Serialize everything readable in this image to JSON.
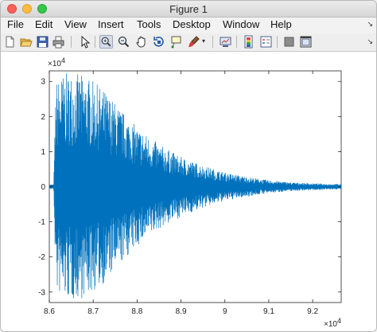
{
  "window": {
    "title": "Figure 1"
  },
  "menu": {
    "items": [
      "File",
      "Edit",
      "View",
      "Insert",
      "Tools",
      "Desktop",
      "Window",
      "Help"
    ],
    "corner_icon": "undock-arrow-icon"
  },
  "toolbar": {
    "icons": [
      "new-figure-icon",
      "open-file-icon",
      "save-icon",
      "print-icon",
      "edit-plot-arrow-icon",
      "zoom-in-icon",
      "zoom-out-icon",
      "pan-hand-icon",
      "rotate-3d-icon",
      "data-cursor-icon",
      "brush-icon",
      "link-plot-icon",
      "insert-colorbar-icon",
      "insert-legend-icon",
      "hide-plot-tools-icon",
      "show-plot-tools-icon"
    ],
    "active_icon": "zoom-in-icon"
  },
  "chart_data": {
    "type": "line",
    "x_multiplier_label": "×10",
    "x_multiplier_exp": "4",
    "y_multiplier_label": "×10",
    "y_multiplier_exp": "4",
    "xlim": [
      86000,
      92650
    ],
    "ylim": [
      -33000,
      33000
    ],
    "x_ticks": [
      {
        "value": 86000,
        "label": "8.6"
      },
      {
        "value": 87000,
        "label": "8.7"
      },
      {
        "value": 88000,
        "label": "8.8"
      },
      {
        "value": 89000,
        "label": "8.9"
      },
      {
        "value": 90000,
        "label": "9"
      },
      {
        "value": 91000,
        "label": "9.1"
      },
      {
        "value": 92000,
        "label": "9.2"
      }
    ],
    "y_ticks": [
      {
        "value": 30000,
        "label": "3"
      },
      {
        "value": 20000,
        "label": "2"
      },
      {
        "value": 10000,
        "label": "1"
      },
      {
        "value": 0,
        "label": "0"
      },
      {
        "value": -10000,
        "label": "-1"
      },
      {
        "value": -20000,
        "label": "-2"
      },
      {
        "value": -30000,
        "label": "-3"
      }
    ],
    "series": [
      {
        "color": "#0072bd",
        "x_start": 86000,
        "x_end": 92650,
        "envelope_x": [
          86000,
          86100,
          86150,
          86300,
          86500,
          86700,
          86900,
          87000,
          87300,
          87500,
          87700,
          88000,
          88500,
          89000,
          89500,
          90000,
          90500,
          91000,
          91500,
          92000,
          92650
        ],
        "envelope_amplitude": [
          600,
          600,
          30000,
          32000,
          32500,
          32000,
          31000,
          30000,
          27000,
          24000,
          21000,
          17000,
          12000,
          8500,
          6000,
          4000,
          2800,
          1800,
          1200,
          900,
          700
        ]
      }
    ]
  }
}
